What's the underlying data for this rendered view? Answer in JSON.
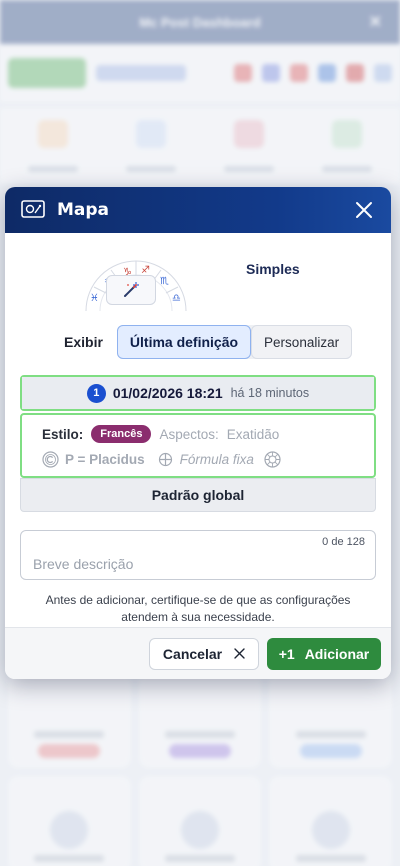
{
  "background": {
    "title": "Mc Post Dashboard"
  },
  "modal": {
    "title": "Mapa",
    "chart_style": "Simples",
    "view": {
      "label": "Exibir",
      "options": [
        "Última definição",
        "Personalizar"
      ],
      "selected": "Última definição"
    },
    "settings": {
      "index": "1",
      "date": "01/02/2026 18:21",
      "ago": "há 18 minutos",
      "style_label": "Estilo:",
      "language": "Francês",
      "aspects_label": "Aspectos:",
      "aspects_value": "Exatidão",
      "house_system": "P = Placidus",
      "formula": "Fórmula fixa"
    },
    "global_button": "Padrão global",
    "description": {
      "placeholder": "Breve descrição",
      "value": "",
      "counter": "0 de 128"
    },
    "hint": "Antes de adicionar, certifique-se de que as configurações atendem à sua necessidade.",
    "cancel_label": "Cancelar",
    "add_prefix": "+1",
    "add_label": "Adicionar"
  },
  "colors": {
    "header": "#0e2a66",
    "accent_green": "#2e8b3e",
    "highlight": "#7fde83",
    "language_pill": "#8b2d6e",
    "badge": "#1a4fd0"
  }
}
